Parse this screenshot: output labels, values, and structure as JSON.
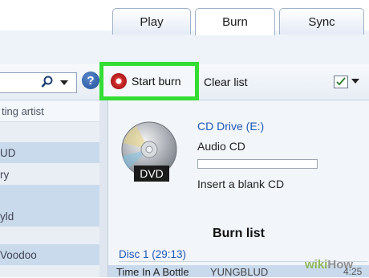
{
  "tabs": [
    {
      "label": "Play"
    },
    {
      "label": "Burn"
    },
    {
      "label": "Sync"
    }
  ],
  "toolbar": {
    "start_burn_label": "Start burn",
    "clear_list_label": "Clear list",
    "help_label": "?"
  },
  "list": {
    "column_header": "ting artist",
    "rows": [
      "UD",
      "ry",
      "yld",
      "Voodoo"
    ]
  },
  "drive": {
    "name": "CD Drive (E:)",
    "disc_type": "Audio CD",
    "media_badge": "DVD",
    "message": "Insert a blank CD"
  },
  "burn_list": {
    "title": "Burn list",
    "disc_header": "Disc 1 (29:13)",
    "track": {
      "name": "Time In A Bottle",
      "artist": "YUNGBLUD",
      "time": "4:25"
    }
  },
  "watermark": {
    "part1": "wiki",
    "part2": "How"
  },
  "colors": {
    "highlight": "#33dd33",
    "link": "#1f58b8",
    "selection": "#c9daed"
  }
}
